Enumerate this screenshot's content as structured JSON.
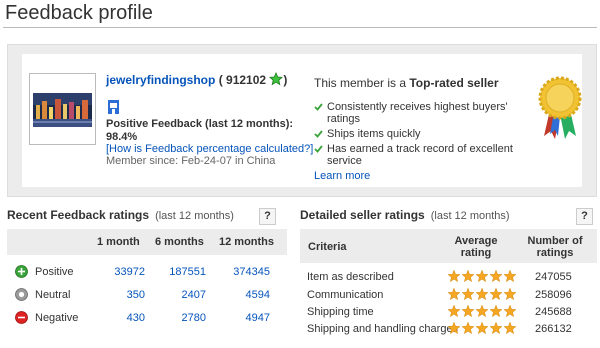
{
  "page": {
    "title": "Feedback profile"
  },
  "profile": {
    "seller_name": "jewelryfindingshop",
    "score_open": "( ",
    "score": "912102",
    "score_close": ")",
    "positive_feedback_label": "Positive Feedback (last 12 months):",
    "positive_feedback_value": "98.4%",
    "how_calculated_link": "[How is Feedback percentage calculated?]",
    "member_since": "Member since: Feb-24-07 in China",
    "top_rated": {
      "prefix": "This member is a ",
      "label": "Top-rated seller",
      "points": [
        "Consistently receives highest buyers' ratings",
        "Ships items quickly",
        "Has earned a track record of excellent service"
      ],
      "learn_more": "Learn more"
    }
  },
  "recent": {
    "title": "Recent Feedback ratings",
    "subtitle": "(last 12 months)",
    "help": "?",
    "columns": [
      "1 month",
      "6 months",
      "12 months"
    ],
    "rows": [
      {
        "label": "Positive",
        "icon": "positive-icon",
        "color": "#3aa33a",
        "values": [
          "33972",
          "187551",
          "374345"
        ]
      },
      {
        "label": "Neutral",
        "icon": "neutral-icon",
        "color": "#8a8a8a",
        "values": [
          "350",
          "2407",
          "4594"
        ]
      },
      {
        "label": "Negative",
        "icon": "negative-icon",
        "color": "#dd2222",
        "values": [
          "430",
          "2780",
          "4947"
        ]
      }
    ]
  },
  "detailed": {
    "title": "Detailed seller ratings",
    "subtitle": "(last 12 months)",
    "help": "?",
    "col_criteria": "Criteria",
    "col_average": "Average rating",
    "col_count": "Number of ratings",
    "rows": [
      {
        "criteria": "Item as described",
        "stars": 5,
        "count": "247055"
      },
      {
        "criteria": "Communication",
        "stars": 5,
        "count": "258096"
      },
      {
        "criteria": "Shipping time",
        "stars": 5,
        "count": "245688"
      },
      {
        "criteria": "Shipping and handling charges",
        "stars": 5,
        "count": "266132"
      }
    ]
  },
  "colors": {
    "link": "#0654ba",
    "star": "#f5a623",
    "panel": "#ececec"
  }
}
